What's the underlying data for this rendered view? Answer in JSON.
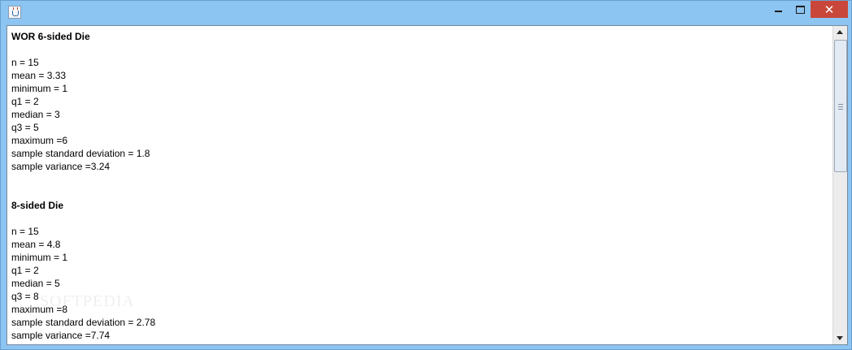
{
  "window": {
    "app_icon": "java-cup-icon",
    "buttons": {
      "minimize_icon": "minimize-icon",
      "maximize_icon": "maximize-icon",
      "close_label": "✕"
    },
    "colors": {
      "frame": "#8cc4f2",
      "close_button": "#c9473a"
    }
  },
  "report": {
    "section1": {
      "title": "WOR 6-sided Die",
      "lines": [
        "n = 15",
        "mean = 3.33",
        "minimum = 1",
        "q1 = 2",
        "median = 3",
        "q3 = 5",
        "maximum =6",
        "sample standard deviation = 1.8",
        "sample variance =3.24"
      ]
    },
    "section2": {
      "title": "8-sided Die",
      "lines": [
        "n = 15",
        "mean = 4.8",
        "minimum = 1",
        "q1 = 2",
        "median = 5",
        "q3 = 8",
        "maximum =8",
        "sample standard deviation = 2.78",
        "sample variance =7.74"
      ]
    }
  },
  "watermark": "SOFTPEDIA",
  "scrollbar": {
    "thumb_fraction": 0.45
  }
}
